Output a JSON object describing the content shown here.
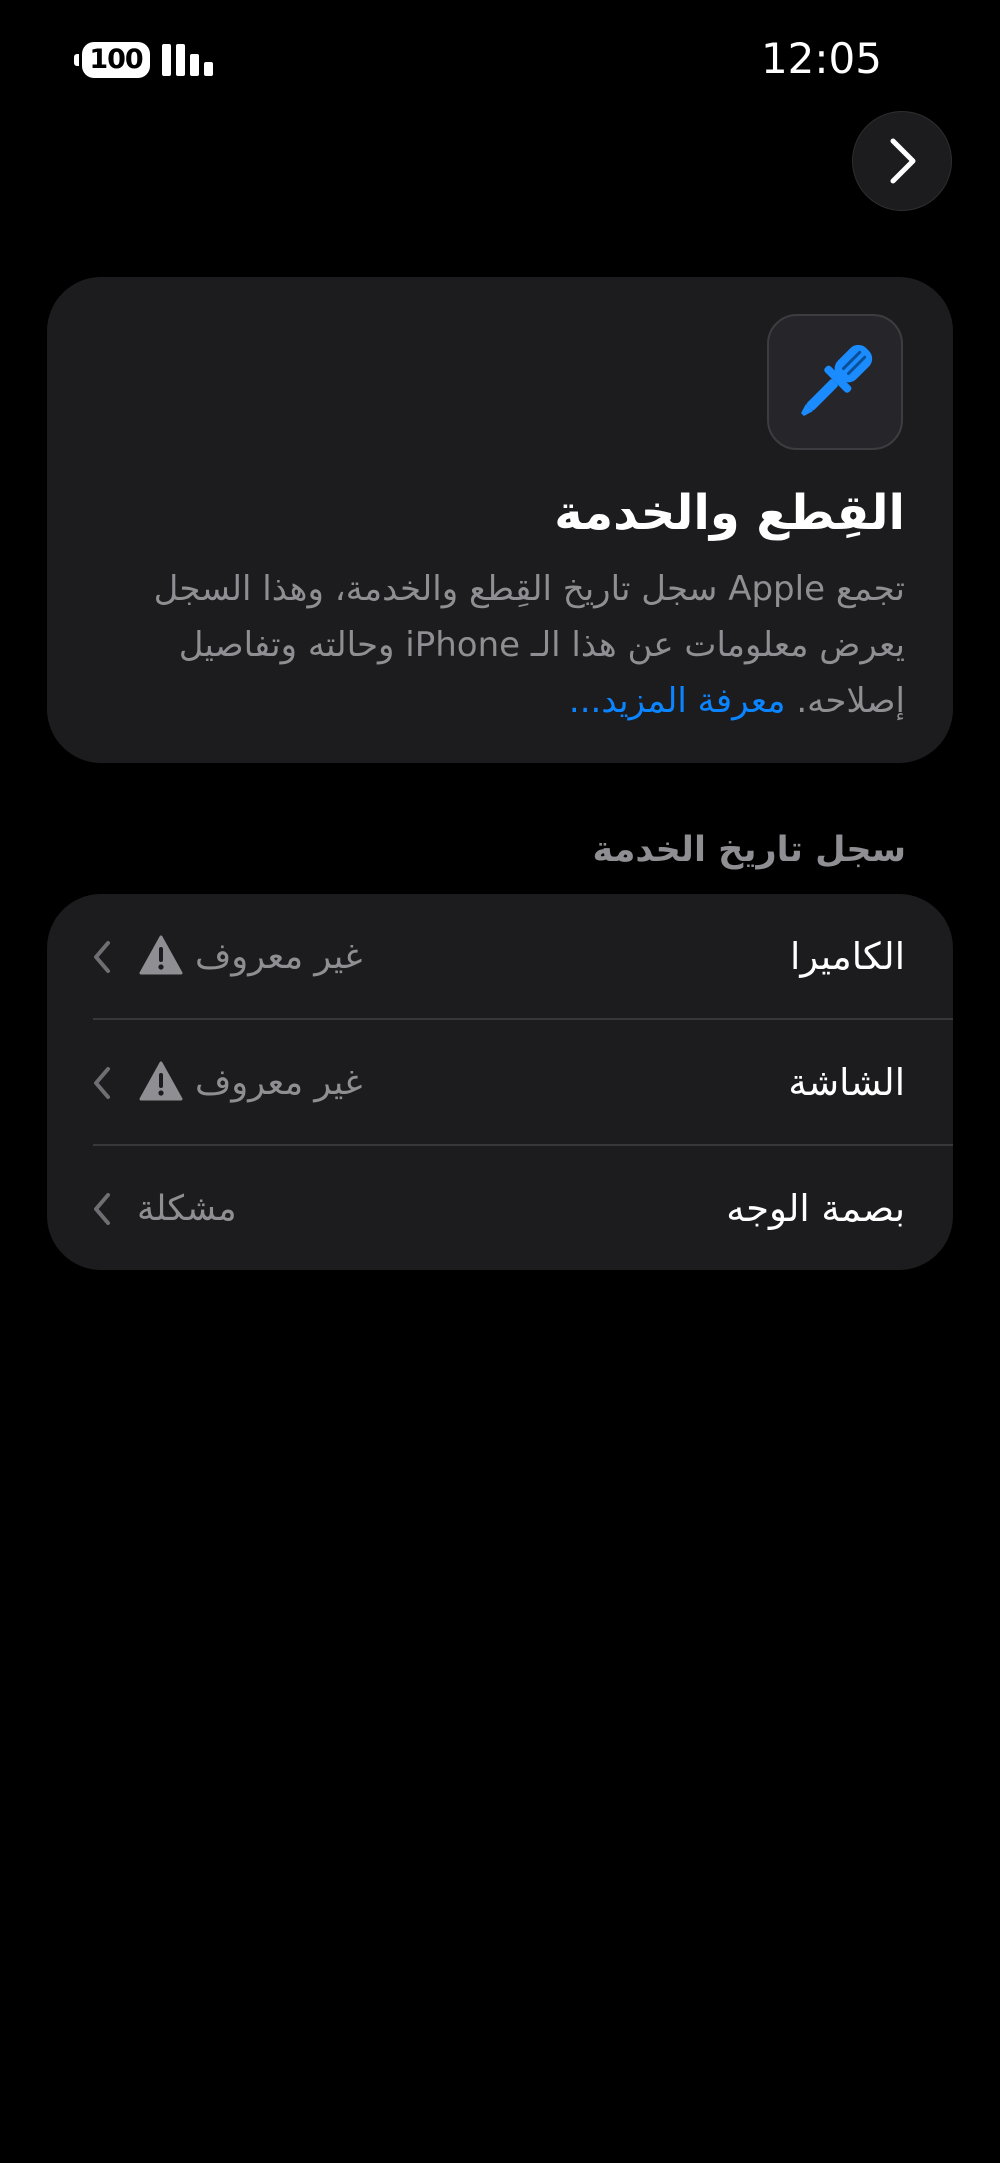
{
  "status_bar": {
    "battery": "100",
    "time": "12:05"
  },
  "info_card": {
    "title": "القِطع والخدمة",
    "description": "تجمع Apple سجل تاريخ القِطع والخدمة، وهذا السجل يعرض معلومات عن هذا الـ iPhone وحالته وتفاصيل إصلاحه.",
    "learn_more": "معرفة المزيد..."
  },
  "service_history": {
    "header": "سجل تاريخ الخدمة",
    "items": [
      {
        "label": "الكاميرا",
        "value": "غير معروف",
        "icon": "warning-icon"
      },
      {
        "label": "الشاشة",
        "value": "غير معروف",
        "icon": "warning-icon"
      },
      {
        "label": "بصمة الوجه",
        "value": "مشكلة",
        "icon": ""
      }
    ]
  },
  "colors": {
    "background": "#000000",
    "card": "#1c1c1e",
    "secondary_text": "#8e8e93",
    "accent": "#0a84ff"
  }
}
